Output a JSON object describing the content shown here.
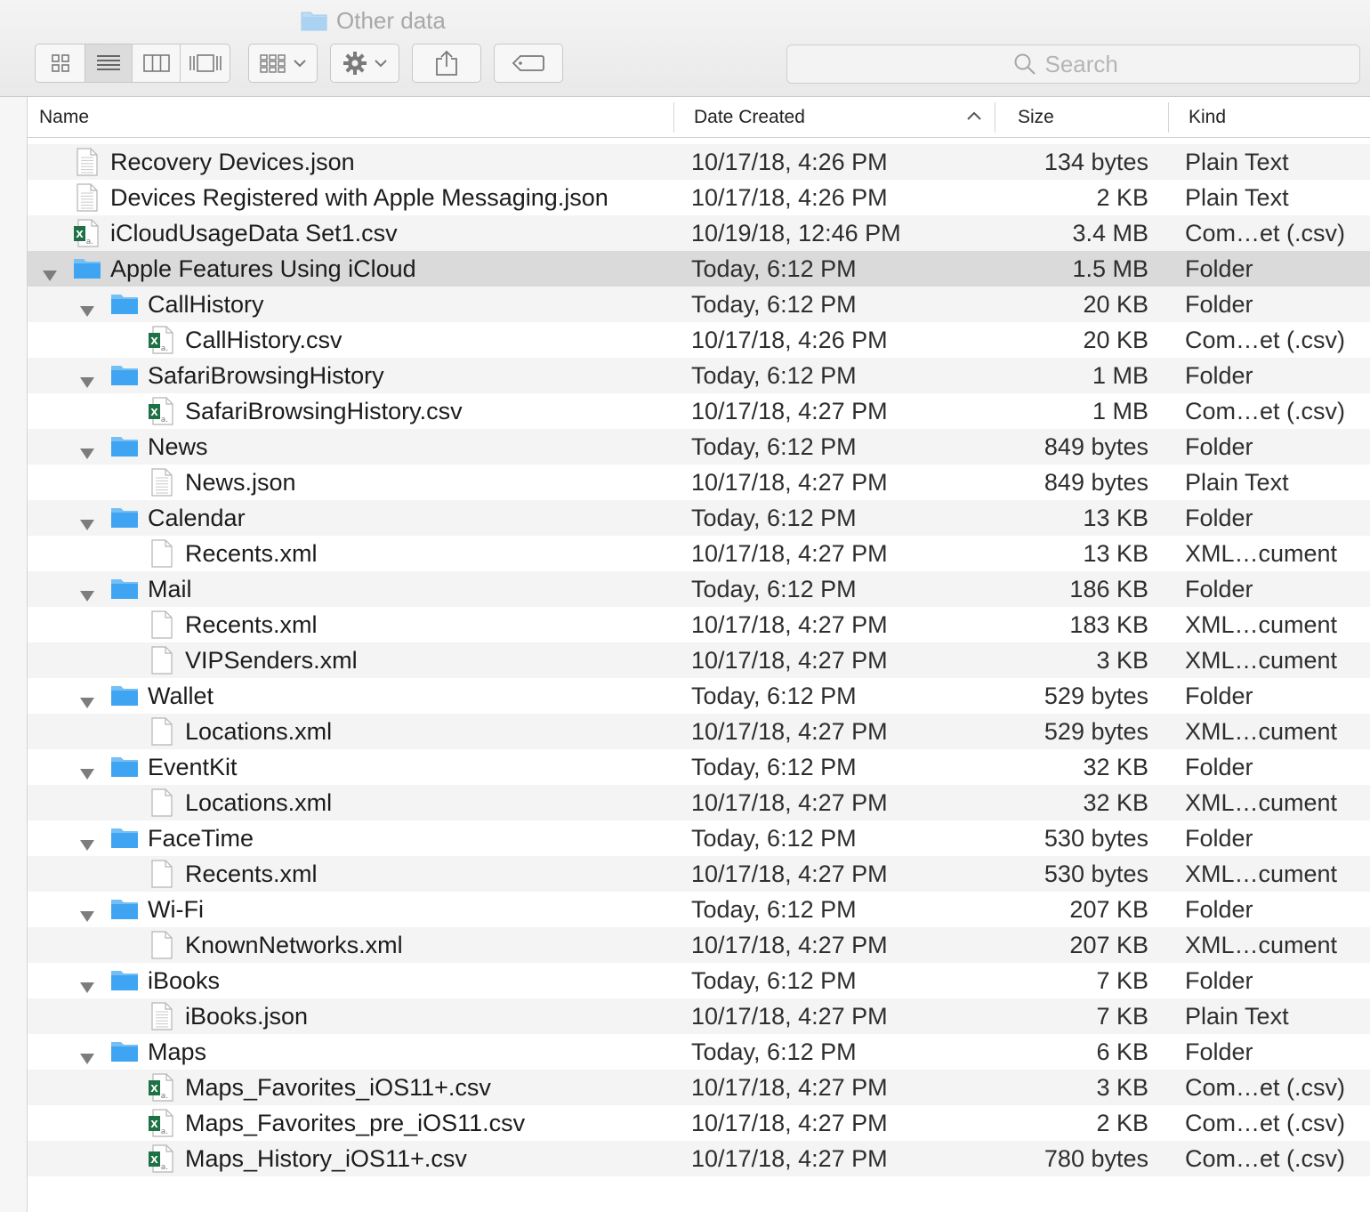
{
  "window": {
    "title": "Other data"
  },
  "toolbar": {
    "view_icons": [
      "icon-view-icon",
      "list-view-icon",
      "column-view-icon",
      "cover-flow-icon"
    ],
    "arrange_icon": "arrange-grid-icon",
    "action_icon": "gear-icon",
    "share_icon": "share-icon",
    "tag_icon": "tag-icon"
  },
  "search": {
    "placeholder": "Search",
    "value": ""
  },
  "columns": {
    "name": "Name",
    "date_created": "Date Created",
    "size": "Size",
    "kind": "Kind"
  },
  "colors": {
    "folder": "#3fa5f2",
    "excel": "#1e7145",
    "selection": "#dadada"
  },
  "files": [
    {
      "level": 0,
      "type": "text",
      "name": "Recovery Devices.json",
      "date": "10/17/18, 4:26 PM",
      "size": "134 bytes",
      "kind": "Plain Text"
    },
    {
      "level": 0,
      "type": "text",
      "name": "Devices Registered with Apple Messaging.json",
      "date": "10/17/18, 4:26 PM",
      "size": "2 KB",
      "kind": "Plain Text"
    },
    {
      "level": 0,
      "type": "csv",
      "name": "iCloudUsageData Set1.csv",
      "date": "10/19/18, 12:46 PM",
      "size": "3.4 MB",
      "kind": "Com…et (.csv)"
    },
    {
      "level": 0,
      "type": "folder",
      "name": "Apple Features Using iCloud",
      "date": "Today, 6:12 PM",
      "size": "1.5 MB",
      "kind": "Folder",
      "expanded": true,
      "selected": true
    },
    {
      "level": 1,
      "type": "folder",
      "name": "CallHistory",
      "date": "Today, 6:12 PM",
      "size": "20 KB",
      "kind": "Folder",
      "expanded": true
    },
    {
      "level": 2,
      "type": "csv",
      "name": "CallHistory.csv",
      "date": "10/17/18, 4:26 PM",
      "size": "20 KB",
      "kind": "Com…et (.csv)"
    },
    {
      "level": 1,
      "type": "folder",
      "name": "SafariBrowsingHistory",
      "date": "Today, 6:12 PM",
      "size": "1 MB",
      "kind": "Folder",
      "expanded": true
    },
    {
      "level": 2,
      "type": "csv",
      "name": "SafariBrowsingHistory.csv",
      "date": "10/17/18, 4:27 PM",
      "size": "1 MB",
      "kind": "Com…et (.csv)"
    },
    {
      "level": 1,
      "type": "folder",
      "name": "News",
      "date": "Today, 6:12 PM",
      "size": "849 bytes",
      "kind": "Folder",
      "expanded": true
    },
    {
      "level": 2,
      "type": "text",
      "name": "News.json",
      "date": "10/17/18, 4:27 PM",
      "size": "849 bytes",
      "kind": "Plain Text"
    },
    {
      "level": 1,
      "type": "folder",
      "name": "Calendar",
      "date": "Today, 6:12 PM",
      "size": "13 KB",
      "kind": "Folder",
      "expanded": true
    },
    {
      "level": 2,
      "type": "blank",
      "name": "Recents.xml",
      "date": "10/17/18, 4:27 PM",
      "size": "13 KB",
      "kind": "XML…cument"
    },
    {
      "level": 1,
      "type": "folder",
      "name": "Mail",
      "date": "Today, 6:12 PM",
      "size": "186 KB",
      "kind": "Folder",
      "expanded": true
    },
    {
      "level": 2,
      "type": "blank",
      "name": "Recents.xml",
      "date": "10/17/18, 4:27 PM",
      "size": "183 KB",
      "kind": "XML…cument"
    },
    {
      "level": 2,
      "type": "blank",
      "name": "VIPSenders.xml",
      "date": "10/17/18, 4:27 PM",
      "size": "3 KB",
      "kind": "XML…cument"
    },
    {
      "level": 1,
      "type": "folder",
      "name": "Wallet",
      "date": "Today, 6:12 PM",
      "size": "529 bytes",
      "kind": "Folder",
      "expanded": true
    },
    {
      "level": 2,
      "type": "blank",
      "name": "Locations.xml",
      "date": "10/17/18, 4:27 PM",
      "size": "529 bytes",
      "kind": "XML…cument"
    },
    {
      "level": 1,
      "type": "folder",
      "name": "EventKit",
      "date": "Today, 6:12 PM",
      "size": "32 KB",
      "kind": "Folder",
      "expanded": true
    },
    {
      "level": 2,
      "type": "blank",
      "name": "Locations.xml",
      "date": "10/17/18, 4:27 PM",
      "size": "32 KB",
      "kind": "XML…cument"
    },
    {
      "level": 1,
      "type": "folder",
      "name": "FaceTime",
      "date": "Today, 6:12 PM",
      "size": "530 bytes",
      "kind": "Folder",
      "expanded": true
    },
    {
      "level": 2,
      "type": "blank",
      "name": "Recents.xml",
      "date": "10/17/18, 4:27 PM",
      "size": "530 bytes",
      "kind": "XML…cument"
    },
    {
      "level": 1,
      "type": "folder",
      "name": "Wi-Fi",
      "date": "Today, 6:12 PM",
      "size": "207 KB",
      "kind": "Folder",
      "expanded": true
    },
    {
      "level": 2,
      "type": "blank",
      "name": "KnownNetworks.xml",
      "date": "10/17/18, 4:27 PM",
      "size": "207 KB",
      "kind": "XML…cument"
    },
    {
      "level": 1,
      "type": "folder",
      "name": "iBooks",
      "date": "Today, 6:12 PM",
      "size": "7 KB",
      "kind": "Folder",
      "expanded": true
    },
    {
      "level": 2,
      "type": "text",
      "name": "iBooks.json",
      "date": "10/17/18, 4:27 PM",
      "size": "7 KB",
      "kind": "Plain Text"
    },
    {
      "level": 1,
      "type": "folder",
      "name": "Maps",
      "date": "Today, 6:12 PM",
      "size": "6 KB",
      "kind": "Folder",
      "expanded": true
    },
    {
      "level": 2,
      "type": "csv",
      "name": "Maps_Favorites_iOS11+.csv",
      "date": "10/17/18, 4:27 PM",
      "size": "3 KB",
      "kind": "Com…et (.csv)"
    },
    {
      "level": 2,
      "type": "csv",
      "name": "Maps_Favorites_pre_iOS11.csv",
      "date": "10/17/18, 4:27 PM",
      "size": "2 KB",
      "kind": "Com…et (.csv)"
    },
    {
      "level": 2,
      "type": "csv",
      "name": "Maps_History_iOS11+.csv",
      "date": "10/17/18, 4:27 PM",
      "size": "780 bytes",
      "kind": "Com…et (.csv)"
    }
  ]
}
